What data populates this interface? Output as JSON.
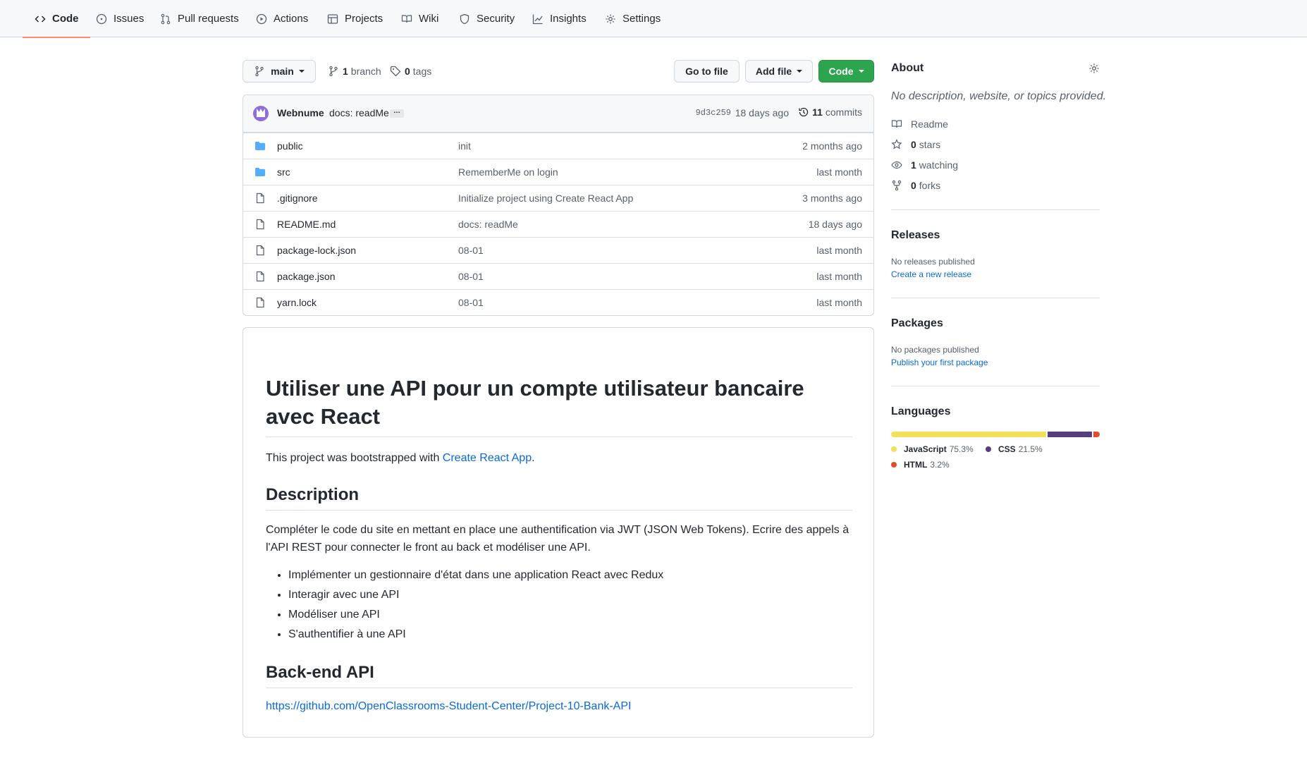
{
  "nav": {
    "tabs": [
      {
        "label": "Code",
        "icon": "code-icon"
      },
      {
        "label": "Issues",
        "icon": "issue-opened-icon"
      },
      {
        "label": "Pull requests",
        "icon": "git-pull-request-icon"
      },
      {
        "label": "Actions",
        "icon": "play-icon"
      },
      {
        "label": "Projects",
        "icon": "table-icon"
      },
      {
        "label": "Wiki",
        "icon": "book-icon"
      },
      {
        "label": "Security",
        "icon": "shield-icon"
      },
      {
        "label": "Insights",
        "icon": "graph-icon"
      },
      {
        "label": "Settings",
        "icon": "gear-icon"
      }
    ],
    "active_tab": "Code",
    "active_color": "#fd8c73"
  },
  "repo_bar": {
    "branch": "main",
    "branch_count": "1",
    "branch_label": "branch",
    "tag_count": "0",
    "tag_label": "tags",
    "go_to_file": "Go to file",
    "add_file": "Add file",
    "code_button": "Code",
    "code_button_color": "#2da44e"
  },
  "commit": {
    "author": "Webnume",
    "message": "docs: readMe",
    "ellipsis": "…",
    "sha": "9d3c259",
    "date": "18 days ago",
    "count": "11",
    "count_label": "commits"
  },
  "files": [
    {
      "name": "public",
      "type": "folder",
      "message": "init",
      "date": "2 months ago"
    },
    {
      "name": "src",
      "type": "folder",
      "message": "RememberMe on login",
      "date": "last month"
    },
    {
      "name": ".gitignore",
      "type": "file",
      "message": "Initialize project using Create React App",
      "date": "3 months ago"
    },
    {
      "name": "README.md",
      "type": "file",
      "message": "docs: readMe",
      "date": "18 days ago"
    },
    {
      "name": "package-lock.json",
      "type": "file",
      "message": "08-01",
      "date": "last month"
    },
    {
      "name": "package.json",
      "type": "file",
      "message": "08-01",
      "date": "last month"
    },
    {
      "name": "yarn.lock",
      "type": "file",
      "message": "08-01",
      "date": "last month"
    }
  ],
  "readme": {
    "title": "Utiliser une API pour un compte utilisateur bancaire avec React",
    "intro_before": "This project was bootstrapped with ",
    "intro_link": "Create React App",
    "intro_after": ".",
    "h_description": "Description",
    "description": "Compléter le code du site en mettant en place une authentification via JWT (JSON Web Tokens). Ecrire des appels à l'API REST pour connecter le front au back et modéliser une API.",
    "bullets": [
      "Implémenter un gestionnaire d'état dans une application React avec Redux",
      "Interagir avec une API",
      "Modéliser une API",
      "S'authentifier à une API"
    ],
    "h_backend": "Back-end API",
    "backend_link": "https://github.com/OpenClassrooms-Student-Center/Project-10-Bank-API"
  },
  "about": {
    "title": "About",
    "description": "No description, website, or topics provided.",
    "readme": "Readme",
    "stars_count": "0",
    "stars_label": "stars",
    "watching_count": "1",
    "watching_label": "watching",
    "forks_count": "0",
    "forks_label": "forks"
  },
  "releases": {
    "title": "Releases",
    "empty": "No releases published",
    "link": "Create a new release"
  },
  "packages": {
    "title": "Packages",
    "empty": "No packages published",
    "link": "Publish your first package"
  },
  "languages": {
    "title": "Languages",
    "items": [
      {
        "name": "JavaScript",
        "percent": "75.3%",
        "value": 75.3,
        "color": "#f1e05a"
      },
      {
        "name": "CSS",
        "percent": "21.5%",
        "value": 21.5,
        "color": "#563d7c"
      },
      {
        "name": "HTML",
        "percent": "3.2%",
        "value": 3.2,
        "color": "#e34c26"
      }
    ]
  }
}
